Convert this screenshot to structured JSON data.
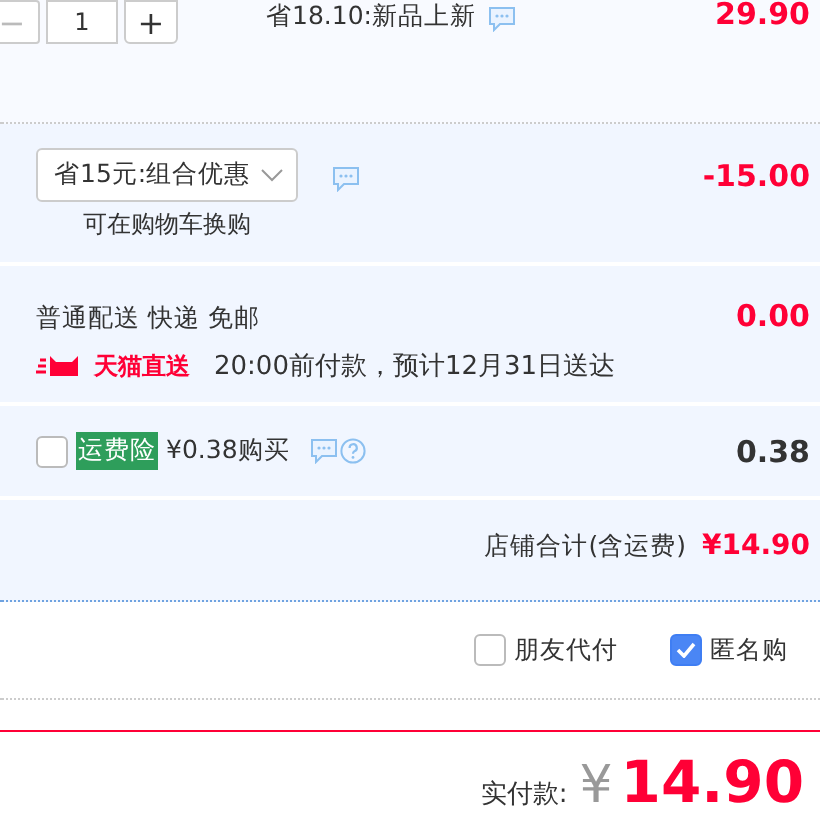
{
  "item": {
    "minus": "−",
    "quantity": "1",
    "plus": "+",
    "promo": "省18.10:新品上新",
    "price": "29.90"
  },
  "discount": {
    "select": "省15元:组合优惠",
    "hint": "可在购物车换购",
    "amount": "-15.00"
  },
  "delivery": {
    "method": "普通配送 快递 免邮",
    "badge": "天猫直送",
    "eta": "20:00前付款，预计12月31日送达",
    "amount": "0.00"
  },
  "insurance": {
    "checked": false,
    "tag": "运费险",
    "offer": "¥0.38购买",
    "amount": "0.38"
  },
  "store_total": {
    "label": "店铺合计(含运费)",
    "amount": "¥14.90"
  },
  "options": [
    {
      "label": "朋友代付",
      "checked": false
    },
    {
      "label": "匿名购",
      "checked": true
    }
  ],
  "payment": {
    "label": "实付款:",
    "currency": "¥",
    "amount": "14.90"
  }
}
